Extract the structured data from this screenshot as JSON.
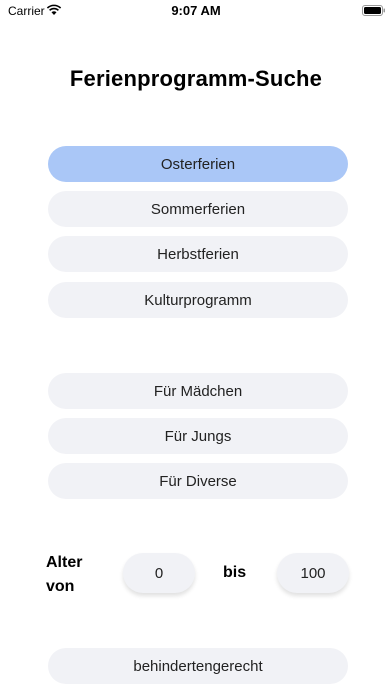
{
  "status_bar": {
    "carrier": "Carrier",
    "time": "9:07 AM"
  },
  "title": "Ferienprogramm-Suche",
  "programs": [
    "Osterferien",
    "Sommerferien",
    "Herbstferien",
    "Kulturprogramm"
  ],
  "selected_program": "Osterferien",
  "genders": [
    "Für Mädchen",
    "Für Jungs",
    "Für Diverse"
  ],
  "age": {
    "label_line1": "Alter",
    "label_line2": "von",
    "from_value": "0",
    "separator": "bis",
    "to_value": "100"
  },
  "accessibility_button": "behindertengerecht",
  "colors": {
    "selected": "#aac7f7",
    "pill_background": "#f1f2f6"
  }
}
